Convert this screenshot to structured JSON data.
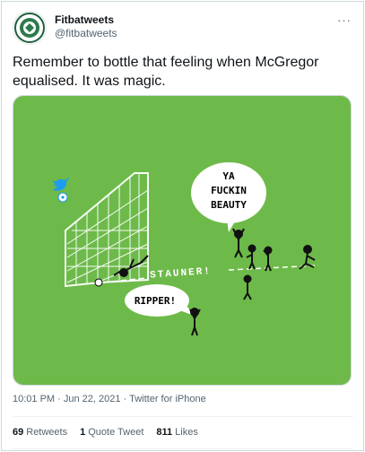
{
  "account": {
    "display_name": "Fitbatweets",
    "handle": "@fitbatweets"
  },
  "more_label": "···",
  "tweet": {
    "text": "Remember to bottle that feeling when McGregor equalised. It was magic."
  },
  "media": {
    "background_color": "#6dba4a",
    "speech_bubble_1": [
      "YA",
      "FUCKIN",
      "BEAUTY"
    ],
    "speech_bubble_2": "RIPPER!",
    "pitch_text": "STAUNER!"
  },
  "meta": {
    "time": "10:01 PM",
    "separator": "·",
    "date": "Jun 22, 2021",
    "source": "Twitter for iPhone"
  },
  "stats": {
    "retweets_count": "69",
    "retweets_label": "Retweets",
    "quotes_count": "1",
    "quotes_label": "Quote Tweet",
    "likes_count": "811",
    "likes_label": "Likes"
  },
  "colors": {
    "text_primary": "#0f1419",
    "text_secondary": "#536471",
    "border": "#cfd9de",
    "pitch_green": "#6dba4a",
    "twitter_blue": "#1d9bf0"
  }
}
